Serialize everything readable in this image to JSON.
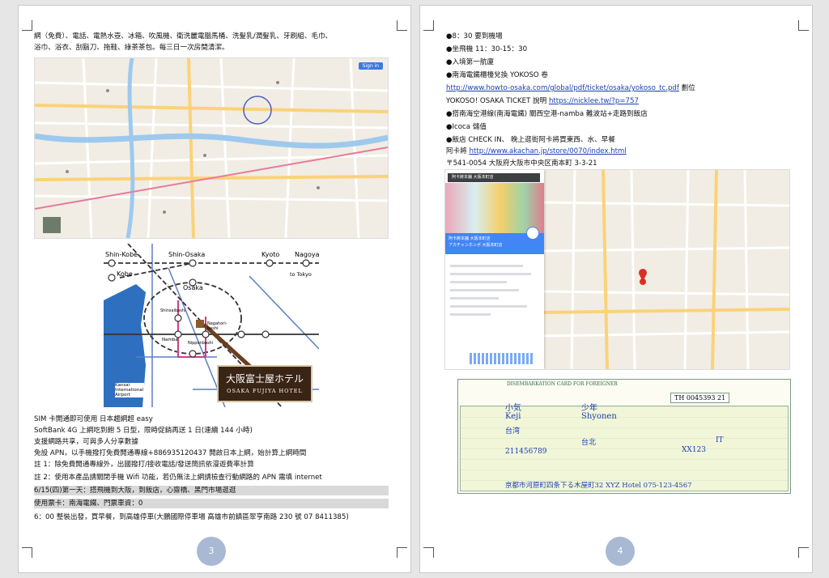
{
  "page3": {
    "intro_line1": "網（免費）、電話、電熱水壺、冰箱、吹風機、衛洗麗電腦馬桶、洗髮乳/潤髮乳、牙刷組、毛巾、",
    "intro_line2": "浴巾、浴衣、刮鬍刀、拖鞋、綠茶茶包。每三日一次房間清潔。",
    "map_signin": "Sign in",
    "rail_map": {
      "stations": [
        "Shin-Kobe",
        "Shin-Osaka",
        "Kyoto",
        "Nagoya",
        "Kobe",
        "to Tokyo",
        "Osaka",
        "Namba",
        "Nagahori-bashi",
        "Nipponbashi",
        "Shinsaibashi",
        "Kansai International Airport"
      ],
      "hotel_name_jp": "大阪富士屋ホテル",
      "hotel_name_en": "OSAKA FUJIYA HOTEL"
    },
    "lines": [
      {
        "text": "SIM 卡開通即可使用  日本趨網超 easy",
        "hl": false
      },
      {
        "text": "SoftBank 4G 上網吃到飽 5 日型，限時促銷再送 1 日(連續 144 小時)",
        "hl": false
      },
      {
        "text": "支援網路共享，可與多人分享數據",
        "hl": false
      },
      {
        "text": "免設 APN，以手機撥打免費開通專線+886935120437 開啟日本上網，始計算上網時間",
        "hl": false
      },
      {
        "text": "註 1：除免費開通專線外，出國撥打/接收電話/發送簡訊依漫遊費率計算",
        "hl": false
      },
      {
        "text": "註 2：使用本產品請關閉手機 Wifi 功能，若仍無法上網請檢查行動網路的 APN 需填 internet",
        "hl": false
      },
      {
        "text": "6/15(四)第一天：搭飛機到大阪，到飯店，心齋橋、黑門市場逛逛",
        "hl": true
      },
      {
        "text": "使用票卡：南海電鐵、門票車資：0",
        "hl": true
      },
      {
        "text": "6：00 整裝出發，買早餐，到高雄停車(大鵬國際停車場 高雄市前鎮區翠亨南路 230 號  07 8411385)",
        "hl": false
      }
    ],
    "page_number": "3"
  },
  "page4": {
    "lines": [
      {
        "text": "●8：30 要到機場",
        "link": ""
      },
      {
        "text": "●坐飛機 11：30-15：30",
        "link": ""
      },
      {
        "text": "●入境第一航廈",
        "link": ""
      },
      {
        "text": "●南海電鐵櫃檯兌換 YOKOSO 卷",
        "link": ""
      },
      {
        "text": "",
        "link": "http://www.howto-osaka.com/global/pdf/ticket/osaka/yokoso_tc.pdf",
        "after": "  劃位"
      },
      {
        "text": "YOKOSO! OSAKA TICKET 說明  ",
        "link": "https://nicklee.tw/?p=757"
      },
      {
        "text": "●搭南海空港線(南海電鐵) 關西空港-namba 難波站+走路到飯店",
        "link": ""
      },
      {
        "text": "●Icoca 儲值",
        "link": ""
      },
      {
        "text": "●飯店 CHECK IN、 晚上逛街阿卡將買東西、水、早餐",
        "link": ""
      },
      {
        "text": "阿卡將  ",
        "link": "http://www.akachan.jp/store/0070/index.html"
      },
      {
        "text": "〒541-0054  大阪府大阪市中央区南本町 3-3-21",
        "link": ""
      }
    ],
    "map_panel": {
      "search_text": "阿卡將本舖 大阪本町店",
      "title": "阿卡將本舖 大阪本町店",
      "subtitle": "アカチャンホンポ 大阪本町店"
    },
    "card": {
      "header": "DISEMBARKATION CARD FOR FOREIGNER",
      "number": "TH 0045393   21",
      "family_name_kanji": "小気",
      "given_name_kanji": "少年",
      "family_name": "Keji",
      "given_name": "Shyonen",
      "nationality": "台湾",
      "city": "台北",
      "occupation": "IT",
      "flight": "XX123",
      "passport": "211456789",
      "address": "京都市河原町四条下る木屋町32 XYZ Hotel   075-123-4567"
    },
    "page_number": "4"
  },
  "colors": {
    "page_bg": "#ffffff",
    "canvas_bg": "#e6e6e6",
    "highlight": "#d9d9d9",
    "link": "#1a3fb5",
    "page_number_bg": "#a9b9d3",
    "hotel_panel": "#3a2414"
  }
}
